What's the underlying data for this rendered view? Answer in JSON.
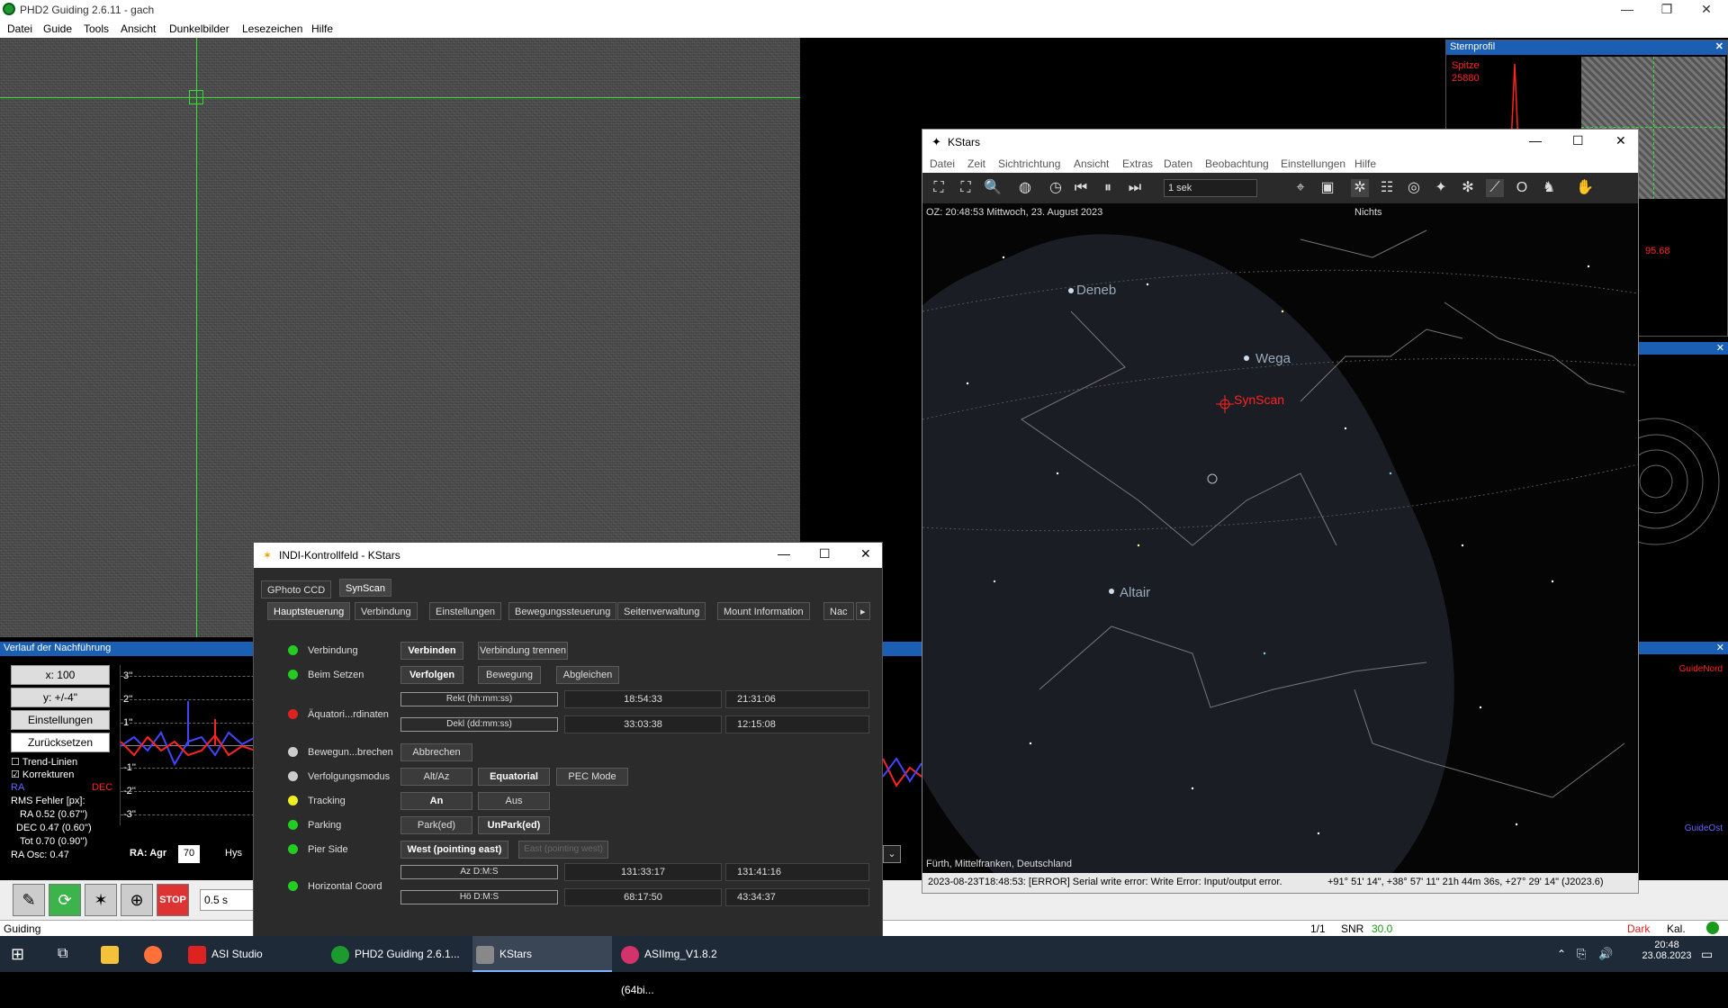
{
  "phd": {
    "title": "PHD2 Guiding 2.6.11 - gach",
    "menu": [
      "Datei",
      "Guide",
      "Tools",
      "Ansicht",
      "Dunkelbilder",
      "Lesezeichen",
      "Hilfe"
    ],
    "profile": {
      "title": "Sternprofil",
      "peak_label": "Spitze",
      "peak_value": "25880",
      "value2": "95.68"
    },
    "history": {
      "title": "Verlauf der Nachführung",
      "x_scale": "x: 100",
      "y_scale": "y: +/-4\"",
      "settings": "Einstellungen",
      "reset": "Zurücksetzen",
      "trend": "Trend-Linien",
      "corrections": "Korrekturen",
      "ra": "RA",
      "dec": "DEC",
      "rms_title": "RMS Fehler [px]:",
      "rms_ra": "RA 0.52 (0.67'')",
      "rms_dec": "DEC 0.47 (0.60'')",
      "rms_tot": "Tot 0.70 (0.90'')",
      "ra_osc": "RA Osc: 0.47",
      "y_ticks": [
        "3''",
        "2''",
        "1''",
        "-1''",
        "-2''",
        "-3''"
      ],
      "ra_agr_label": "RA: Agr",
      "ra_agr_value": "70",
      "hys": "Hys"
    },
    "exposure": "0.5 s",
    "status": {
      "mode": "Guiding",
      "frames": "1/1",
      "snr_label": "SNR",
      "snr_value": "30.0",
      "dark": "Dark",
      "cal": "Kal."
    },
    "guide_north": "GuideNord",
    "guide_east": "GuideOst"
  },
  "kstars": {
    "title": "KStars",
    "menu": [
      "Datei",
      "Zeit",
      "Sichtrichtung",
      "Ansicht",
      "Extras",
      "Daten",
      "Beobachtung",
      "Einstellungen",
      "Hilfe"
    ],
    "time_step": "1 sek",
    "info_time": "OZ: 20:48:53  Mittwoch, 23. August 2023",
    "info_focus": "Nichts",
    "labels": {
      "deneb": "Deneb",
      "wega": "Wega",
      "altair": "Altair",
      "synscan": "SynScan"
    },
    "location": "Fürth, Mittelfranken, Deutschland",
    "status_msg": "2023-08-23T18:48:53: [ERROR] Serial write error: Write Error: Input/output error.",
    "status_coords": "+91° 51' 14\", +38° 57' 11\"  21h 44m 36s, +27° 29' 14\" (J2023.6)"
  },
  "indi": {
    "title": "INDI-Kontrollfeld - KStars",
    "device_tabs": [
      "GPhoto CCD",
      "SynScan"
    ],
    "tabs": [
      "Hauptsteuerung",
      "Verbindung",
      "Einstellungen",
      "Bewegungssteuerung",
      "Seitenverwaltung",
      "Mount Information",
      "Nac"
    ],
    "rows": {
      "connection": {
        "label": "Verbindung",
        "btn1": "Verbinden",
        "btn2": "Verbindung trennen"
      },
      "on_set": {
        "label": "Beim Setzen",
        "btn1": "Verfolgen",
        "btn2": "Bewegung",
        "btn3": "Abgleichen"
      },
      "equatorial": {
        "label": "Äquatori...rdinaten",
        "ra_lbl": "Rekt (hh:mm:ss)",
        "ra_v1": "18:54:33",
        "ra_v2": "21:31:06",
        "dec_lbl": "Dekl (dd:mm:ss)",
        "dec_v1": "33:03:38",
        "dec_v2": "12:15:08"
      },
      "abort": {
        "label": "Bewegun...brechen",
        "btn1": "Abbrechen"
      },
      "track_mode": {
        "label": "Verfolgungsmodus",
        "btn1": "Alt/Az",
        "btn2": "Equatorial",
        "btn3": "PEC Mode"
      },
      "tracking": {
        "label": "Tracking",
        "btn1": "An",
        "btn2": "Aus"
      },
      "parking": {
        "label": "Parking",
        "btn1": "Park(ed)",
        "btn2": "UnPark(ed)"
      },
      "pier": {
        "label": "Pier Side",
        "btn1": "West (pointing east)",
        "btn2": "East (pointing west)"
      },
      "horizontal": {
        "label": "Horizontal Coord",
        "az_lbl": "Az D:M:S",
        "az_v1": "131:33:17",
        "az_v2": "131:41:16",
        "alt_lbl": "Hö D:M:S",
        "alt_v1": "68:17:50",
        "alt_v2": "43:34:37"
      }
    }
  },
  "taskbar": {
    "apps": [
      "ASI Studio",
      "PHD2 Guiding 2.6.1...",
      "KStars",
      "ASIImg_V1.8.2 (64bi..."
    ],
    "time": "20:48",
    "date": "23.08.2023"
  }
}
